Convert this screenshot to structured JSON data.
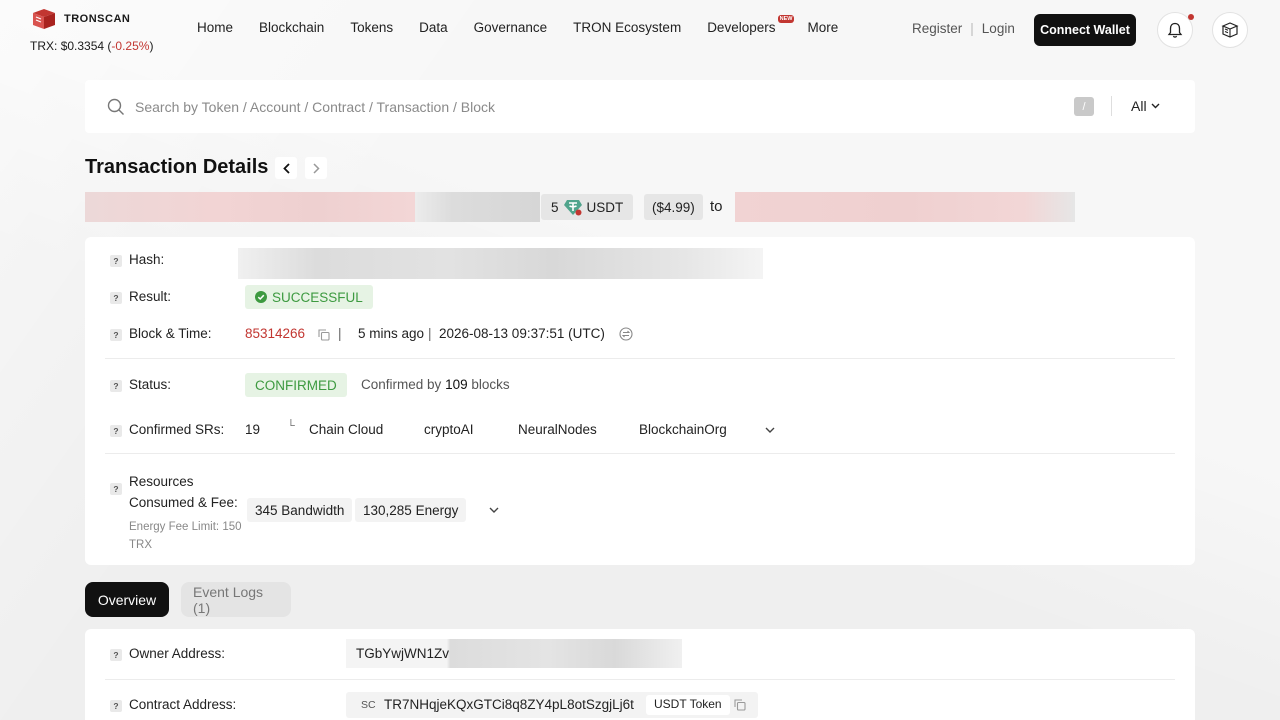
{
  "header": {
    "logo_text": "TRONSCAN",
    "price_label": "TRX:",
    "price_value": "$0.3354",
    "price_change": "-0.25%",
    "nav": [
      "Home",
      "Blockchain",
      "Tokens",
      "Data",
      "Governance",
      "TRON Ecosystem",
      "Developers",
      "More"
    ],
    "new_badge": "NEW",
    "register": "Register",
    "login": "Login",
    "connect_wallet": "Connect Wallet"
  },
  "search": {
    "placeholder": "Search by Token / Account / Contract / Transaction / Block",
    "shortcut": "/",
    "filter": "All"
  },
  "page": {
    "title": "Transaction Details"
  },
  "summary": {
    "amount": "5",
    "token": "USDT",
    "usd_value": "($4.99)",
    "to": "to"
  },
  "details": {
    "hash_label": "Hash:",
    "result_label": "Result:",
    "result_value": "SUCCESSFUL",
    "block_label": "Block & Time:",
    "block_number": "85314266",
    "age": "5 mins ago",
    "timestamp": "2026-08-13 09:37:51 (UTC)",
    "status_label": "Status:",
    "status_value": "CONFIRMED",
    "confirmed_prefix": "Confirmed by",
    "confirmed_count": "109",
    "confirmed_suffix": "blocks",
    "srs_label": "Confirmed SRs:",
    "srs_count": "19",
    "srs": [
      "Chain Cloud",
      "cryptoAI",
      "NeuralNodes",
      "BlockchainOrg"
    ],
    "resources_label_line1": "Resources",
    "resources_label_line2": "Consumed & Fee:",
    "energy_fee_limit_line1": "Energy Fee Limit: 150",
    "energy_fee_limit_line2": "TRX",
    "bandwidth_value": "345",
    "bandwidth_unit": "Bandwidth",
    "energy_value": "130,285",
    "energy_unit": "Energy"
  },
  "tabs": {
    "overview": "Overview",
    "event_logs": "Event Logs (1)"
  },
  "overview": {
    "owner_label": "Owner Address:",
    "owner_value": "TGbYwjWN1Zv",
    "contract_label": "Contract Address:",
    "contract_tag": "SC",
    "contract_value": "TR7NHqjeKQxGTCi8q8ZY4pL8otSzgjLj6t",
    "contract_token": "USDT Token"
  },
  "colors": {
    "accent_red": "#c23631",
    "success_green": "#3d9a40",
    "dark": "#111111"
  }
}
